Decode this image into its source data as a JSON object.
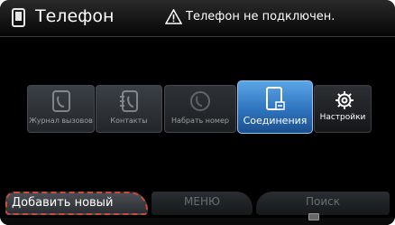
{
  "header": {
    "title": "Телефон",
    "status": "Телефон не подключен."
  },
  "tiles": [
    {
      "label": "Журнал вызовов",
      "icon": "phone-log-icon"
    },
    {
      "label": "Контакты",
      "icon": "contacts-icon"
    },
    {
      "label": "Набрать номер",
      "icon": "dial-icon"
    },
    {
      "label": "Соединения",
      "icon": "connections-icon",
      "active": true
    },
    {
      "label": "Настройки",
      "icon": "gear-icon"
    }
  ],
  "bottom_tabs": {
    "add_new": "Добавить новый",
    "menu": "МЕНЮ",
    "search": "Поиск"
  },
  "colors": {
    "accent": "#3a86d6",
    "highlight_outline": "#d04a38"
  }
}
